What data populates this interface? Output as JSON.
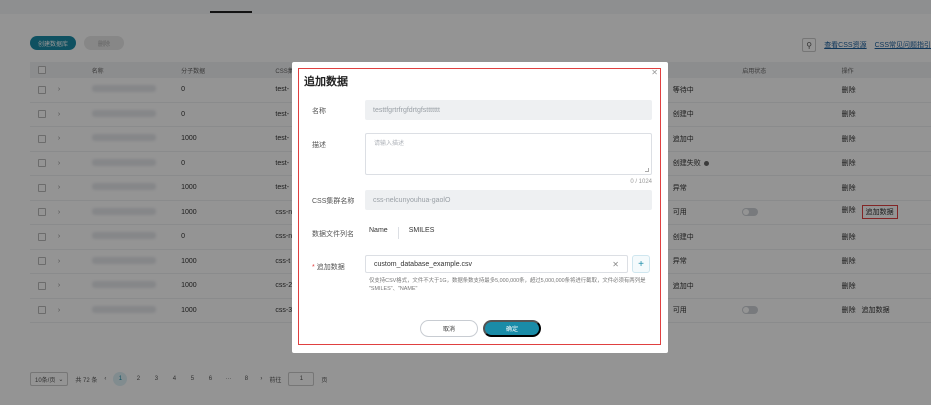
{
  "toolbar": {
    "create_label": "创建数据库",
    "delete_label": "删除",
    "view_css_link": "查看CSS资源",
    "css_faq_link": "CSS常见问题指引"
  },
  "table": {
    "headers": {
      "name": "名称",
      "count": "分子数据",
      "css": "CSS集",
      "switch": "启用状态",
      "ops": "操作"
    },
    "rows": [
      {
        "count": "0",
        "css": "test-",
        "status": "等待中",
        "status_dot": false,
        "toggle": false,
        "ops": [
          "删除"
        ],
        "ops_framed": false
      },
      {
        "count": "0",
        "css": "test-",
        "status": "创建中",
        "status_dot": false,
        "toggle": false,
        "ops": [
          "删除"
        ],
        "ops_framed": false
      },
      {
        "count": "1000",
        "css": "test-",
        "status": "追加中",
        "status_dot": false,
        "toggle": false,
        "ops": [
          "删除"
        ],
        "ops_framed": false
      },
      {
        "count": "0",
        "css": "test-",
        "status": "创建失败",
        "status_dot": true,
        "toggle": false,
        "ops": [
          "删除"
        ],
        "ops_framed": false
      },
      {
        "count": "1000",
        "css": "test-",
        "status": "异常",
        "status_dot": false,
        "toggle": false,
        "ops": [
          "删除"
        ],
        "ops_framed": false
      },
      {
        "count": "1000",
        "css": "css-n",
        "status": "可用",
        "status_dot": false,
        "toggle": true,
        "ops": [
          "删除",
          "追加数据"
        ],
        "ops_framed": true
      },
      {
        "count": "0",
        "css": "css-n",
        "status": "创建中",
        "status_dot": false,
        "toggle": false,
        "ops": [
          "删除"
        ],
        "ops_framed": false
      },
      {
        "count": "1000",
        "css": "css-t",
        "status": "异常",
        "status_dot": false,
        "toggle": false,
        "ops": [
          "删除"
        ],
        "ops_framed": false
      },
      {
        "count": "1000",
        "css": "css-2",
        "status": "追加中",
        "status_dot": false,
        "toggle": false,
        "ops": [
          "删除"
        ],
        "ops_framed": false
      },
      {
        "count": "1000",
        "css": "css-3",
        "status": "可用",
        "status_dot": false,
        "toggle": true,
        "ops": [
          "删除",
          "追加数据"
        ],
        "ops_framed": false
      }
    ]
  },
  "pager": {
    "page_size": "10条/页",
    "total": "共 72 条",
    "pages": [
      "1",
      "2",
      "3",
      "4",
      "5",
      "6",
      "···",
      "8"
    ],
    "current": "1",
    "goto_label": "前往",
    "goto_value": "1",
    "page_suffix": "页"
  },
  "dialog": {
    "title": "追加数据",
    "name_label": "名称",
    "name_value": "testtfgrtrfrgfdrtgfsttttttt",
    "desc_label": "描述",
    "desc_placeholder": "请输入描述",
    "desc_counter": "0 / 1024",
    "css_label": "CSS集群名称",
    "css_value": "css-nelcunyouhua-gaolO",
    "column_label": "数据文件列名",
    "column_name": "Name",
    "column_smiles": "SMILES",
    "append_label": "追加数据",
    "file_name": "custom_database_example.csv",
    "hint": "仅支持CSV格式，文件不大于1G，数据条数支持最多5,000,000条，超过5,000,000条将进行截取，文件必须有两列是 \"SMILES\"、\"NAME\"",
    "cancel_label": "取消",
    "ok_label": "确定"
  }
}
